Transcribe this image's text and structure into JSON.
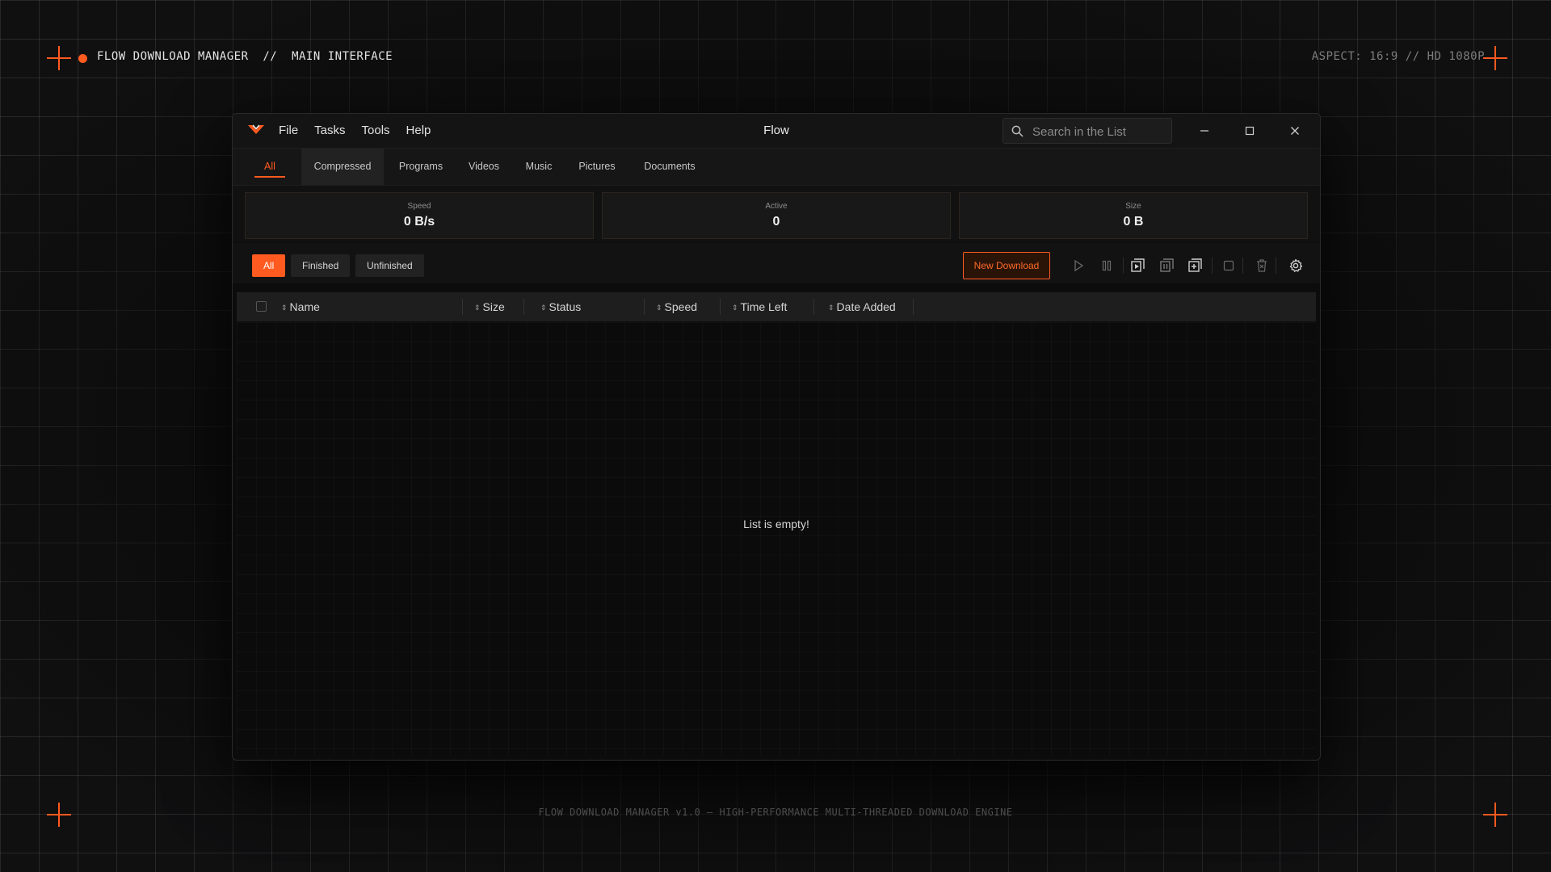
{
  "hud": {
    "title": "FLOW DOWNLOAD MANAGER  //  MAIN INTERFACE",
    "aspect": "ASPECT: 16:9 // HD 1080P",
    "footer": "FLOW DOWNLOAD MANAGER v1.0 — HIGH-PERFORMANCE MULTI-THREADED DOWNLOAD ENGINE",
    "accent_color": "#ff5a1f"
  },
  "window": {
    "title": "Flow",
    "menu": [
      "File",
      "Tasks",
      "Tools",
      "Help"
    ],
    "search_placeholder": "Search in the List"
  },
  "categories": {
    "items": [
      "All",
      "Compressed",
      "Programs",
      "Videos",
      "Music",
      "Pictures",
      "Documents"
    ],
    "active": "All"
  },
  "stats": {
    "speed": {
      "label": "Speed",
      "value": "0 B/s"
    },
    "active": {
      "label": "Active",
      "value": "0"
    },
    "size": {
      "label": "Size",
      "value": "0 B"
    }
  },
  "filters": {
    "items": [
      "All",
      "Finished",
      "Unfinished"
    ],
    "active": "All"
  },
  "toolbar": {
    "new_download": "New Download",
    "icons": [
      "play-icon",
      "pause-icon",
      "resume-all-icon",
      "pause-all-icon",
      "add-batch-icon",
      "stop-icon",
      "delete-icon",
      "settings-icon"
    ]
  },
  "table": {
    "columns": [
      "Name",
      "Size",
      "Status",
      "Speed",
      "Time Left",
      "Date Added"
    ],
    "empty_message": "List is empty!"
  }
}
